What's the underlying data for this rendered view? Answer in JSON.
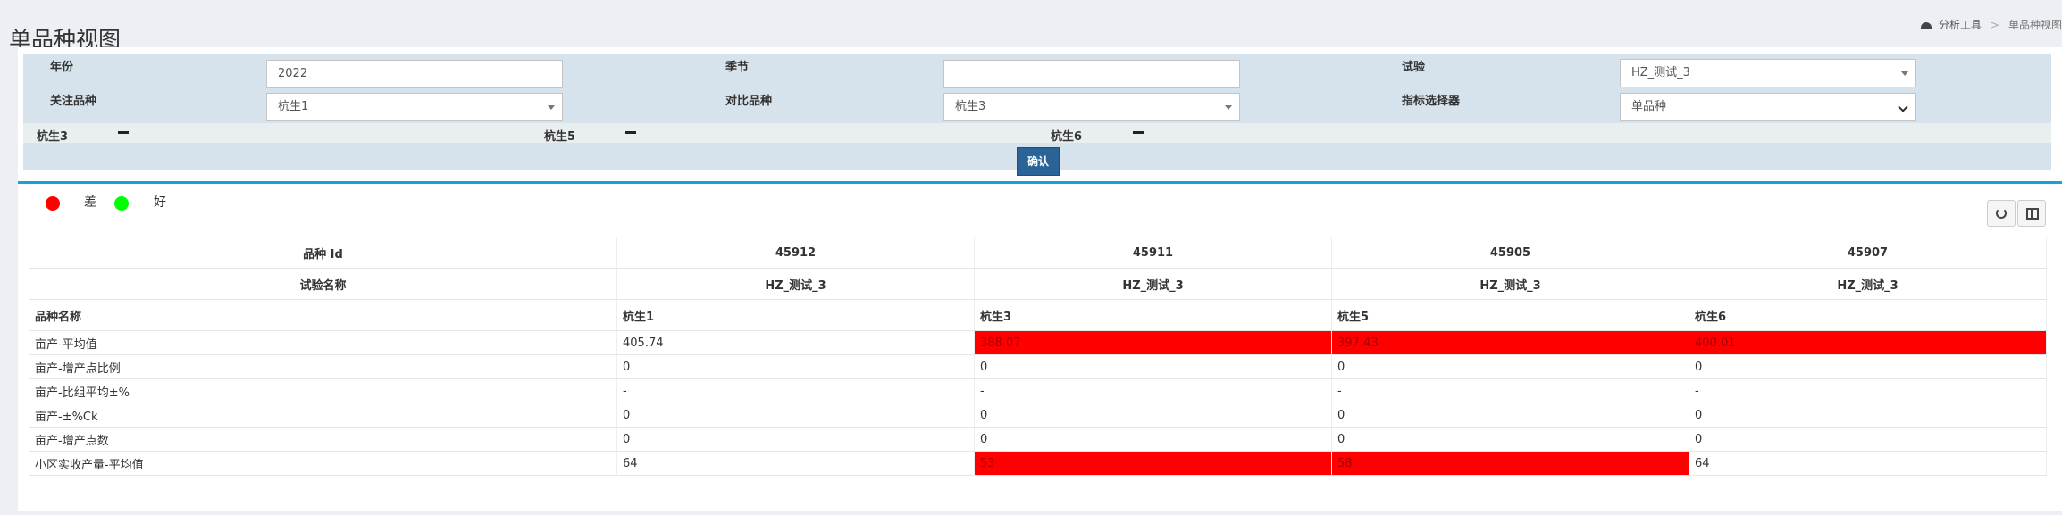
{
  "header": {
    "title": "单品种视图",
    "breadcrumb": {
      "parent": "分析工具",
      "current": "单品种视图"
    }
  },
  "filters": {
    "year": {
      "label": "年份",
      "value": "2022"
    },
    "season": {
      "label": "季节",
      "value": ""
    },
    "trial": {
      "label": "试验",
      "value": "HZ_测试_3"
    },
    "focus_variety": {
      "label": "关注品种",
      "value": "杭生1"
    },
    "compare_variety": {
      "label": "对比品种",
      "value": "杭生3"
    },
    "indicator": {
      "label": "指标选择器",
      "value": "单品种"
    },
    "selected_tags": [
      "杭生3",
      "杭生5",
      "杭生6"
    ],
    "confirm_label": "确认"
  },
  "legend": {
    "bad": "差",
    "good": "好",
    "bad_color": "#ff0000",
    "good_color": "#00ff00"
  },
  "table": {
    "id_label": "品种 Id",
    "trial_label": "试验名称",
    "name_label": "品种名称",
    "ids": [
      "45912",
      "45911",
      "45905",
      "45907"
    ],
    "trial_names": [
      "HZ_测试_3",
      "HZ_测试_3",
      "HZ_测试_3",
      "HZ_测试_3"
    ],
    "varieties": [
      "杭生1",
      "杭生3",
      "杭生5",
      "杭生6"
    ],
    "rows": [
      {
        "label": "亩产-平均值",
        "values": [
          "405.74",
          "388.07",
          "397.43",
          "400.01"
        ]
      },
      {
        "label": "亩产-增产点比例",
        "values": [
          "0",
          "0",
          "0",
          "0"
        ]
      },
      {
        "label": "亩产-比组平均±%",
        "values": [
          "-",
          "-",
          "-",
          "-"
        ]
      },
      {
        "label": "亩产-±%Ck",
        "values": [
          "0",
          "0",
          "0",
          "0"
        ]
      },
      {
        "label": "亩产-增产点数",
        "values": [
          "0",
          "0",
          "0",
          "0"
        ]
      },
      {
        "label": "小区实收产量-平均值",
        "values": [
          "64",
          "53",
          "58",
          "64"
        ]
      }
    ],
    "bad_cells": [
      [
        0,
        1
      ],
      [
        0,
        2
      ],
      [
        0,
        3
      ],
      [
        5,
        1
      ],
      [
        5,
        2
      ]
    ]
  }
}
